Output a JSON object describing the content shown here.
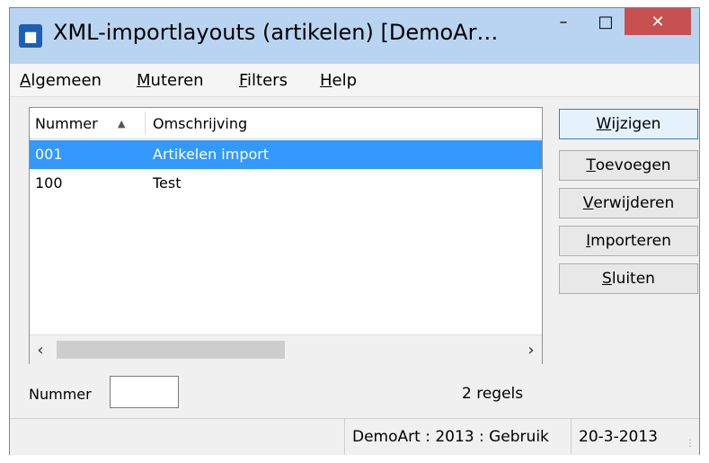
{
  "window": {
    "title": "XML-importlayouts (artikelen)  [DemoAr…",
    "minimize_glyph": "–",
    "maximize_glyph": "□",
    "close_glyph": "✕",
    "icon": "app-icon"
  },
  "menu": [
    {
      "accel": "A",
      "rest": "lgemeen"
    },
    {
      "accel": "M",
      "rest": "uteren"
    },
    {
      "accel": "F",
      "rest": "ilters"
    },
    {
      "accel": "H",
      "rest": "elp"
    }
  ],
  "grid": {
    "columns": [
      "Nummer",
      "Omschrijving"
    ],
    "sort_glyph": "▲",
    "rows": [
      {
        "nummer": "001",
        "omschrijving": "Artikelen import",
        "selected": true
      },
      {
        "nummer": "100",
        "omschrijving": "Test",
        "selected": false
      }
    ],
    "scroll_left_glyph": "‹",
    "scroll_right_glyph": "›"
  },
  "buttons": [
    {
      "accel": "W",
      "rest": "ijzigen"
    },
    {
      "accel": "T",
      "rest": "oevoegen"
    },
    {
      "accel": "V",
      "rest": "erwijderen"
    },
    {
      "accel": "I",
      "rest": "mporteren"
    },
    {
      "accel": "S",
      "rest": "luiten"
    }
  ],
  "filter": {
    "label": "Nummer",
    "value": ""
  },
  "count": "2 regels",
  "status": {
    "left": "DemoArt : 2013 : Gebruik",
    "right": "20-3-2013"
  },
  "colors": {
    "selection": "#3399ff",
    "close": "#c75050",
    "titlebar": "#b8d4f0"
  }
}
